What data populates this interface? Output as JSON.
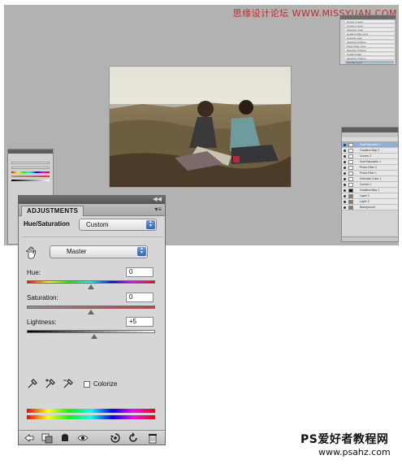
{
  "watermark": {
    "top": "思缘设计论坛 WWW.MISSYUAN.COM",
    "bottom": "PS爱好者教程网",
    "url": "www.psahz.com"
  },
  "adjustments": {
    "tab_label": "ADJUSTMENTS",
    "title": "Hue/Saturation",
    "preset": "Custom",
    "channel": "Master",
    "hue": {
      "label": "Hue:",
      "value": "0",
      "position": 0.5
    },
    "saturation": {
      "label": "Saturation:",
      "value": "0",
      "position": 0.5
    },
    "lightness": {
      "label": "Lightness:",
      "value": "+5",
      "position": 0.525
    },
    "colorize_label": "Colorize",
    "colorize_checked": false
  },
  "layers": {
    "top_panel_rows": [
      "Curves 3 Layer",
      "Curves 2 Layer",
      "Selective Color",
      "Gradient Map Layer",
      "Hue/Sat Layer",
      "Selective Change",
      "Photo Filter Layer",
      "Selective Change",
      "Gradient Map",
      "Selective Change",
      "Hue/Sat Layer"
    ],
    "rows": [
      {
        "name": "Hue/Saturation 2",
        "thumb": "white",
        "selected": true
      },
      {
        "name": "Gradient Map 2",
        "thumb": "white",
        "selected": false
      },
      {
        "name": "Curves 3",
        "thumb": "white",
        "selected": false
      },
      {
        "name": "Hue/Saturation 1",
        "thumb": "white",
        "selected": false
      },
      {
        "name": "Photo Filter 2",
        "thumb": "white",
        "selected": false
      },
      {
        "name": "Photo Filter 1",
        "thumb": "white",
        "selected": false
      },
      {
        "name": "Selective Color 1",
        "thumb": "white",
        "selected": false
      },
      {
        "name": "Curves 1",
        "thumb": "white",
        "selected": false
      },
      {
        "name": "Gradient Map 1",
        "thumb": "dark",
        "selected": false
      },
      {
        "name": "Layer 1",
        "thumb": "photo",
        "selected": false
      },
      {
        "name": "Layer 2",
        "thumb": "photo",
        "selected": false
      },
      {
        "name": "Background",
        "thumb": "photo",
        "selected": false
      }
    ]
  },
  "colors": {
    "workspace": "#b2b2b2",
    "panel": "#d6d6d6",
    "accent_blue": "#2f66b8"
  }
}
